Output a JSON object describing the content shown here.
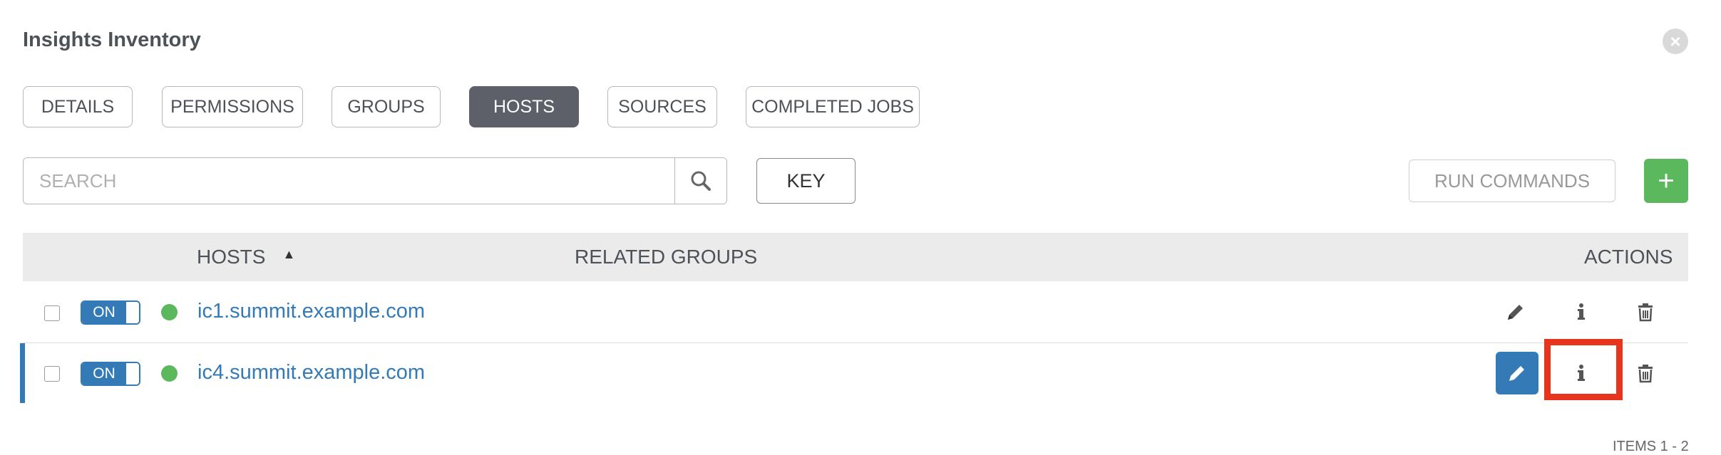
{
  "panel": {
    "title": "Insights Inventory"
  },
  "tabs": [
    {
      "label": "DETAILS"
    },
    {
      "label": "PERMISSIONS"
    },
    {
      "label": "GROUPS"
    },
    {
      "label": "HOSTS",
      "active": true
    },
    {
      "label": "SOURCES"
    },
    {
      "label": "COMPLETED JOBS"
    }
  ],
  "toolbar": {
    "search_placeholder": "SEARCH",
    "key_label": "KEY",
    "run_commands_label": "RUN COMMANDS",
    "add_label": "+"
  },
  "table": {
    "columns": {
      "hosts": "HOSTS",
      "related_groups": "RELATED GROUPS",
      "actions": "ACTIONS"
    },
    "rows": [
      {
        "toggle": "ON",
        "status": "ok",
        "host": "ic1.summit.example.com",
        "selected": false
      },
      {
        "toggle": "ON",
        "status": "ok",
        "host": "ic4.summit.example.com",
        "selected": true
      }
    ]
  },
  "icons": {
    "close": "close-circle-icon",
    "search": "search-icon",
    "edit": "pencil-icon",
    "info": "info-icon",
    "delete": "trash-icon",
    "sort": "sort-ascending-icon"
  },
  "footer": {
    "items_text": "ITEMS 1 - 2"
  },
  "colors": {
    "accent": "#337ab7",
    "active_tab": "#5d6068",
    "success": "#5cb85c",
    "highlight": "#e8341c",
    "header_bg": "#ebebeb"
  }
}
